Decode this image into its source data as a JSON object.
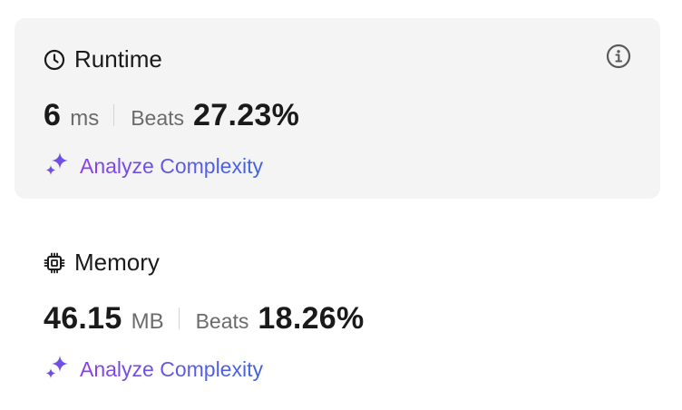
{
  "runtime": {
    "title": "Runtime",
    "value": "6",
    "unit": "ms",
    "beats_label": "Beats",
    "beats_value": "27.23%",
    "analyze_label": "Analyze Complexity",
    "icon": "clock-icon",
    "info_icon": "info-icon"
  },
  "memory": {
    "title": "Memory",
    "value": "46.15",
    "unit": "MB",
    "beats_label": "Beats",
    "beats_value": "18.26%",
    "analyze_label": "Analyze Complexity",
    "icon": "chip-icon"
  },
  "colors": {
    "card_background": "#f4f4f5",
    "analyze_gradient_start": "#8b3fe6",
    "analyze_gradient_end": "#3f63e6",
    "muted_text": "#6b6b6b"
  }
}
